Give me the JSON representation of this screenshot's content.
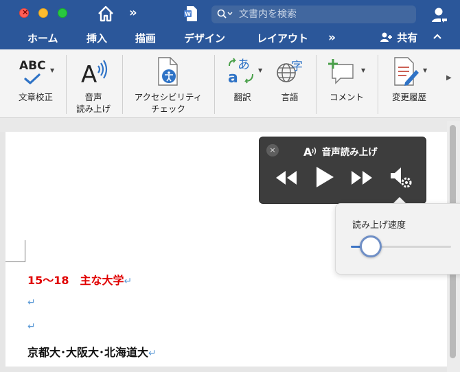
{
  "titlebar": {
    "search_placeholder": "文書内を検索",
    "qa_more": "»"
  },
  "tabs": {
    "home": "ホーム",
    "insert": "挿入",
    "draw": "描画",
    "design": "デザイン",
    "layout": "レイアウト",
    "more": "»",
    "share": "共有",
    "collapse": "^"
  },
  "ribbon": {
    "spelling_icon_text": "ABC",
    "spelling": "文章校正",
    "read_aloud_line1": "音声",
    "read_aloud_line2": "読み上げ",
    "accessibility_line1": "アクセシビリティ",
    "accessibility_line2": "チェック",
    "translate": "翻訳",
    "language": "言語",
    "comment": "コメント",
    "track_changes": "変更履歴"
  },
  "document": {
    "heading": "15〜18　主な大学",
    "body_line": "京都大･大阪大･北海道大",
    "para_mark": "↵",
    "heading_color": "#e00000"
  },
  "read_aloud_panel": {
    "title": "音声読み上げ",
    "close": "×"
  },
  "speed_popover": {
    "label": "読み上げ速度",
    "speed_fraction": 0.2
  },
  "colors": {
    "ribbon_blue": "#2b579a",
    "panel_dark": "#3d3d3d",
    "accent_blue": "#3d74c5"
  }
}
